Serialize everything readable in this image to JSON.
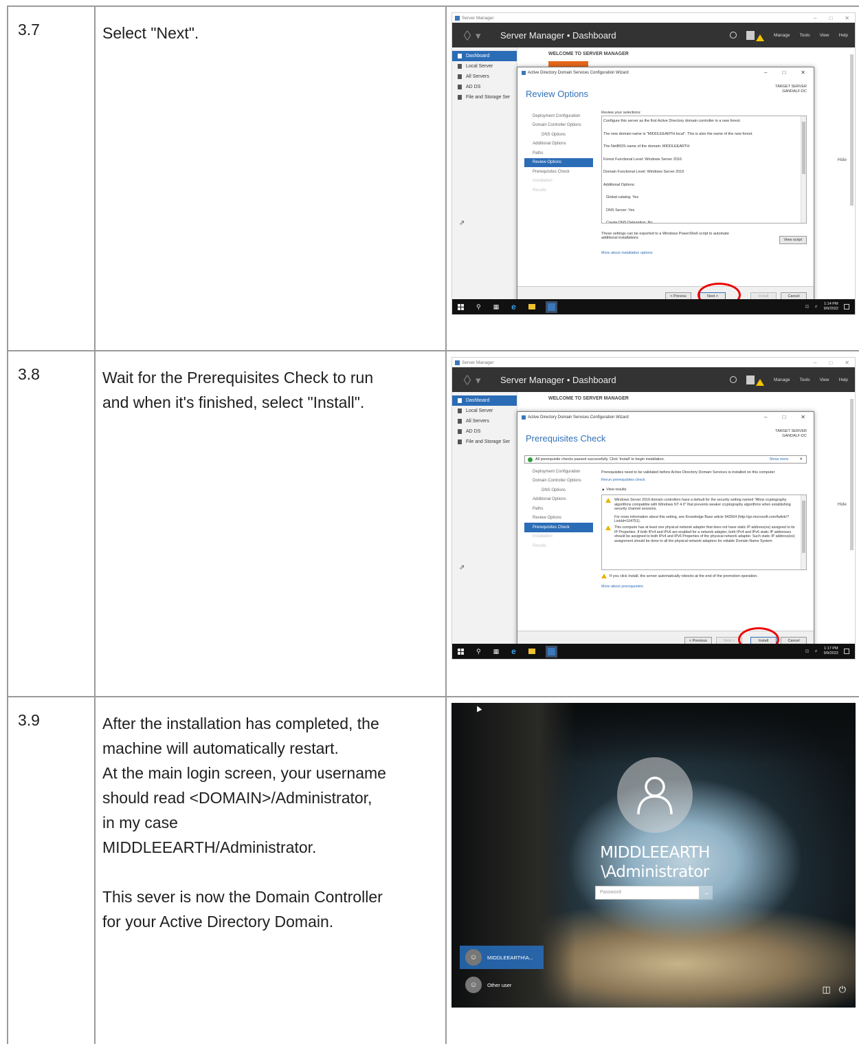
{
  "rows": [
    {
      "number": "3.7",
      "paragraphs": [
        [
          "Select \"Next\"."
        ]
      ]
    },
    {
      "number": "3.8",
      "paragraphs": [
        [
          "Wait for the Prerequisites Check to run",
          "and when it's finished, select \"Install\"."
        ]
      ]
    },
    {
      "number": "3.9",
      "paragraphs": [
        [
          "After the installation has completed, the",
          "machine will automatically restart.",
          "At the main login screen, your username",
          "should read <DOMAIN>/Administrator,",
          "in my case",
          "MIDDLEEARTH/Administrator."
        ],
        [
          "This sever is now the Domain Controller",
          "for your Active Directory Domain."
        ]
      ]
    }
  ],
  "server_manager": {
    "window_title": "Server Manager",
    "header_title": "Server Manager • Dashboard",
    "menu": [
      "Manage",
      "Tools",
      "View",
      "Help"
    ],
    "sidebar": [
      "Dashboard",
      "Local Server",
      "All Servers",
      "AD DS",
      "File and Storage Ser"
    ],
    "welcome": "WELCOME TO SERVER MANAGER",
    "hide": "Hide",
    "wizard_title": "Active Directory Domain Services Configuration Wizard",
    "target_server_label": "TARGET SERVER",
    "target_server_name": "GANDALF-DC",
    "nav_steps": [
      "Deployment Configuration",
      "Domain Controller Options",
      "DNS Options",
      "Additional Options",
      "Paths",
      "Review Options",
      "Prerequisites Check",
      "Installation",
      "Results"
    ],
    "buttons": {
      "previous": "< Previous",
      "next": "Next >",
      "install": "Install",
      "cancel": "Cancel"
    },
    "taskbar_date": "9/9/2022"
  },
  "shot1": {
    "page_title": "Review Options",
    "review_label": "Review your selections:",
    "selections": [
      "Configure this server as the first Active Directory domain controller in a new forest.",
      "The new domain name is \"MIDDLEEARTH.local\". This is also the name of the new forest.",
      "The NetBIOS name of the domain: MIDDLEEARTH",
      "Forest Functional Level: Windows Server 2016",
      "Domain Functional Level: Windows Server 2016",
      "Additional Options:",
      "Global catalog: Yes",
      "DNS Server: Yes",
      "Create DNS Delegation: No"
    ],
    "export_note": "These settings can be exported to a Windows PowerShell script to automate additional installations",
    "view_script": "View script",
    "more_link": "More about installation options",
    "previous_label": "< Previou",
    "time": "1:14 PM"
  },
  "shot2": {
    "page_title": "Prerequisites Check",
    "banner": "All prerequisite checks passed successfully.  Click 'Install' to begin installation.",
    "show_more": "Show more",
    "intro": "Prerequisites need to be validated before Active Directory Domain Services is installed on this computer",
    "rerun": "Rerun prerequisites check",
    "view_results": "View results",
    "results": [
      "Windows Server 2019 domain controllers have a default for the security setting named \"Allow cryptography algorithms compatible with Windows NT 4.0\" that prevents weaker cryptography algorithms when establishing security channel sessions.",
      "For more information about this setting, see Knowledge Base article 942564 (http://go.microsoft.com/fwlink/?LinkId=104751).",
      "This computer has at least one physical network adapter that does not have static IP address(es) assigned to its IP Properties. If both IPv4 and IPv6 are enabled for a network adapter, both IPv4 and IPv6 static IP addresses should be assigned to both IPv4 and IPv6 Properties of the physical network adapter. Such static IP address(es) assignment should be done to all the physical network adapters for reliable Domain Name System"
    ],
    "reboot_warning": "If you click Install, the server automatically reboots at the end of the promotion operation.",
    "more_link": "More about prerequisites",
    "time": "1:17 PM"
  },
  "login": {
    "user_line1": "MIDDLEEARTH",
    "user_line2": "\\Administrator",
    "password_placeholder": "Password",
    "accounts": [
      "MIDDLEEARTH\\A...",
      "Other user"
    ]
  }
}
